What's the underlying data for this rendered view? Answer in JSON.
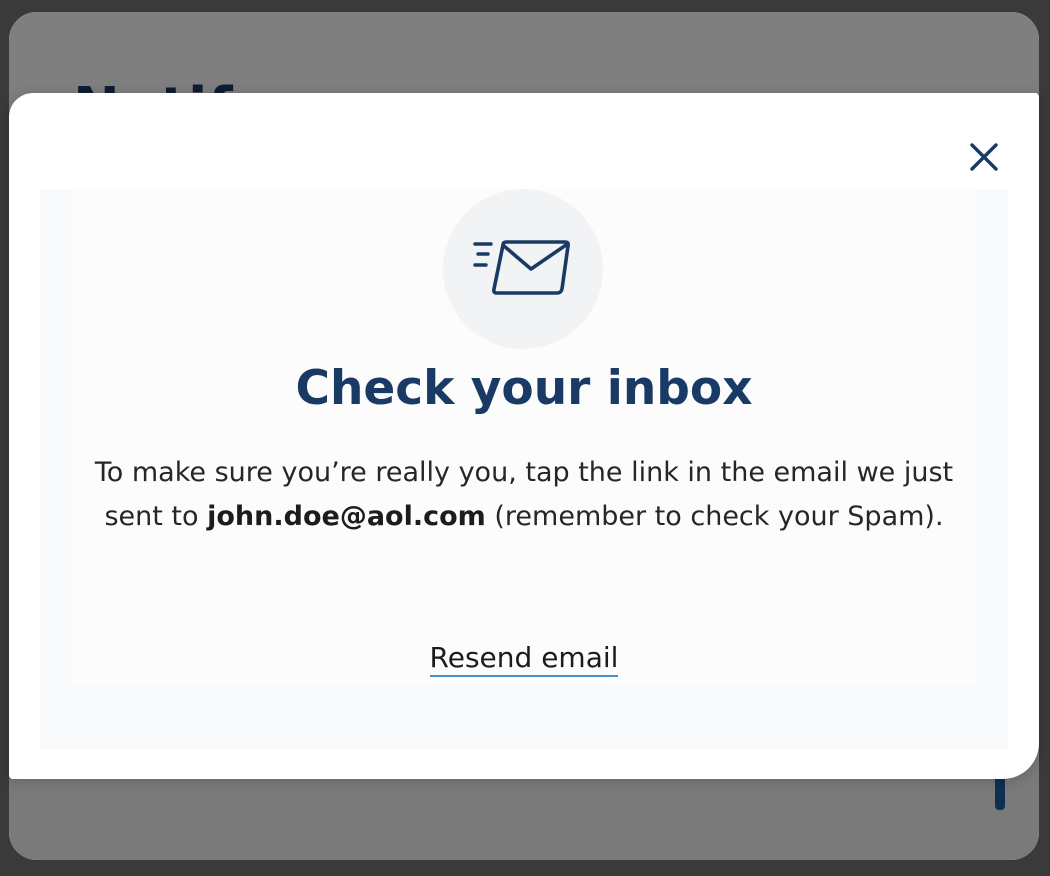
{
  "background": {
    "title": "Notif",
    "side_text": "O"
  },
  "modal": {
    "close_label": "Close",
    "icon": "email-sent-icon",
    "heading": "Check your inbox",
    "message_before": "To make sure you’re really you, tap the link in the email we just sent to ",
    "email": "john.doe@aol.com",
    "message_after": " (remember to check your Spam).",
    "resend_label": "Resend email"
  },
  "colors": {
    "primary": "#1a3a66",
    "link_underline": "#4a90c8",
    "icon_bg": "#f1f3f5"
  }
}
